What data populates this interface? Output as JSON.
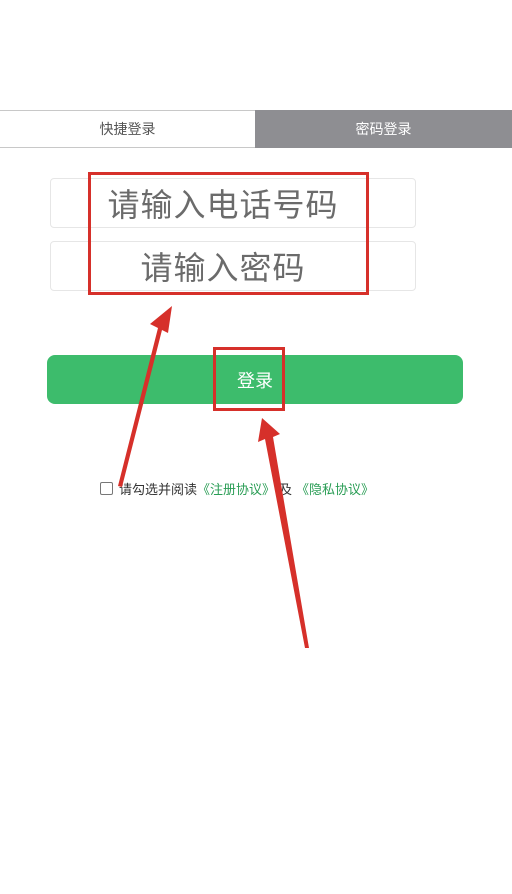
{
  "tabs": {
    "quick_login": "快捷登录",
    "password_login": "密码登录"
  },
  "form": {
    "phone_placeholder": "请输入电话号码",
    "password_placeholder": "请输入密码",
    "login_label": "登录"
  },
  "agreement": {
    "prefix": "请勾选并阅读",
    "register_link": "《注册协议》",
    "joiner": "及",
    "privacy_link": "《隐私协议》",
    "checked": false
  },
  "annotations": {
    "highlight_color": "#d6302a"
  },
  "colors": {
    "accent_green": "#3dbc6c",
    "link_green": "#2a9d55",
    "active_tab_bg": "#8e8e92"
  }
}
